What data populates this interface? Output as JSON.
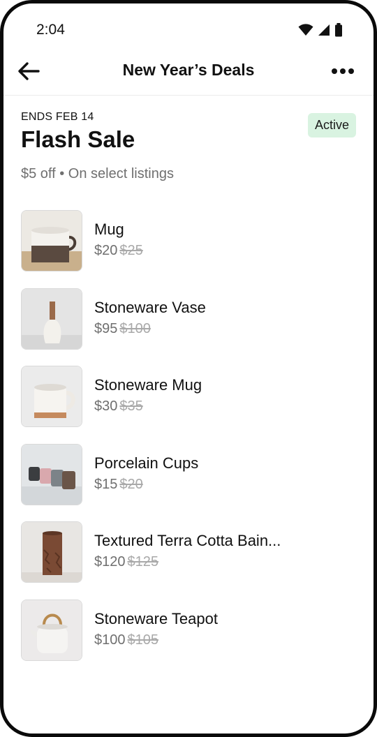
{
  "status_bar": {
    "time": "2:04",
    "icons": [
      "wifi-icon",
      "signal-icon",
      "battery-icon"
    ]
  },
  "app_bar": {
    "title": "New Year’s Deals",
    "back_icon": "arrow-left-icon",
    "more_icon": "more-horizontal-icon"
  },
  "sale": {
    "ends_label": "ENDS FEB 14",
    "title": "Flash Sale",
    "status": "Active",
    "description": "$5 off • On select listings"
  },
  "listings": [
    {
      "name": "Mug",
      "price": "$20",
      "original_price": "$25"
    },
    {
      "name": "Stoneware Vase",
      "price": "$95",
      "original_price": "$100"
    },
    {
      "name": "Stoneware Mug",
      "price": "$30",
      "original_price": "$35"
    },
    {
      "name": "Porcelain Cups",
      "price": "$15",
      "original_price": "$20"
    },
    {
      "name": "Textured Terra Cotta Bain...",
      "price": "$120",
      "original_price": "$125"
    },
    {
      "name": "Stoneware Teapot",
      "price": "$100",
      "original_price": "$105"
    }
  ],
  "colors": {
    "badge_bg": "#d9f3e1",
    "muted_text": "#6f6f6f",
    "strike_text": "#a9a9a9"
  }
}
